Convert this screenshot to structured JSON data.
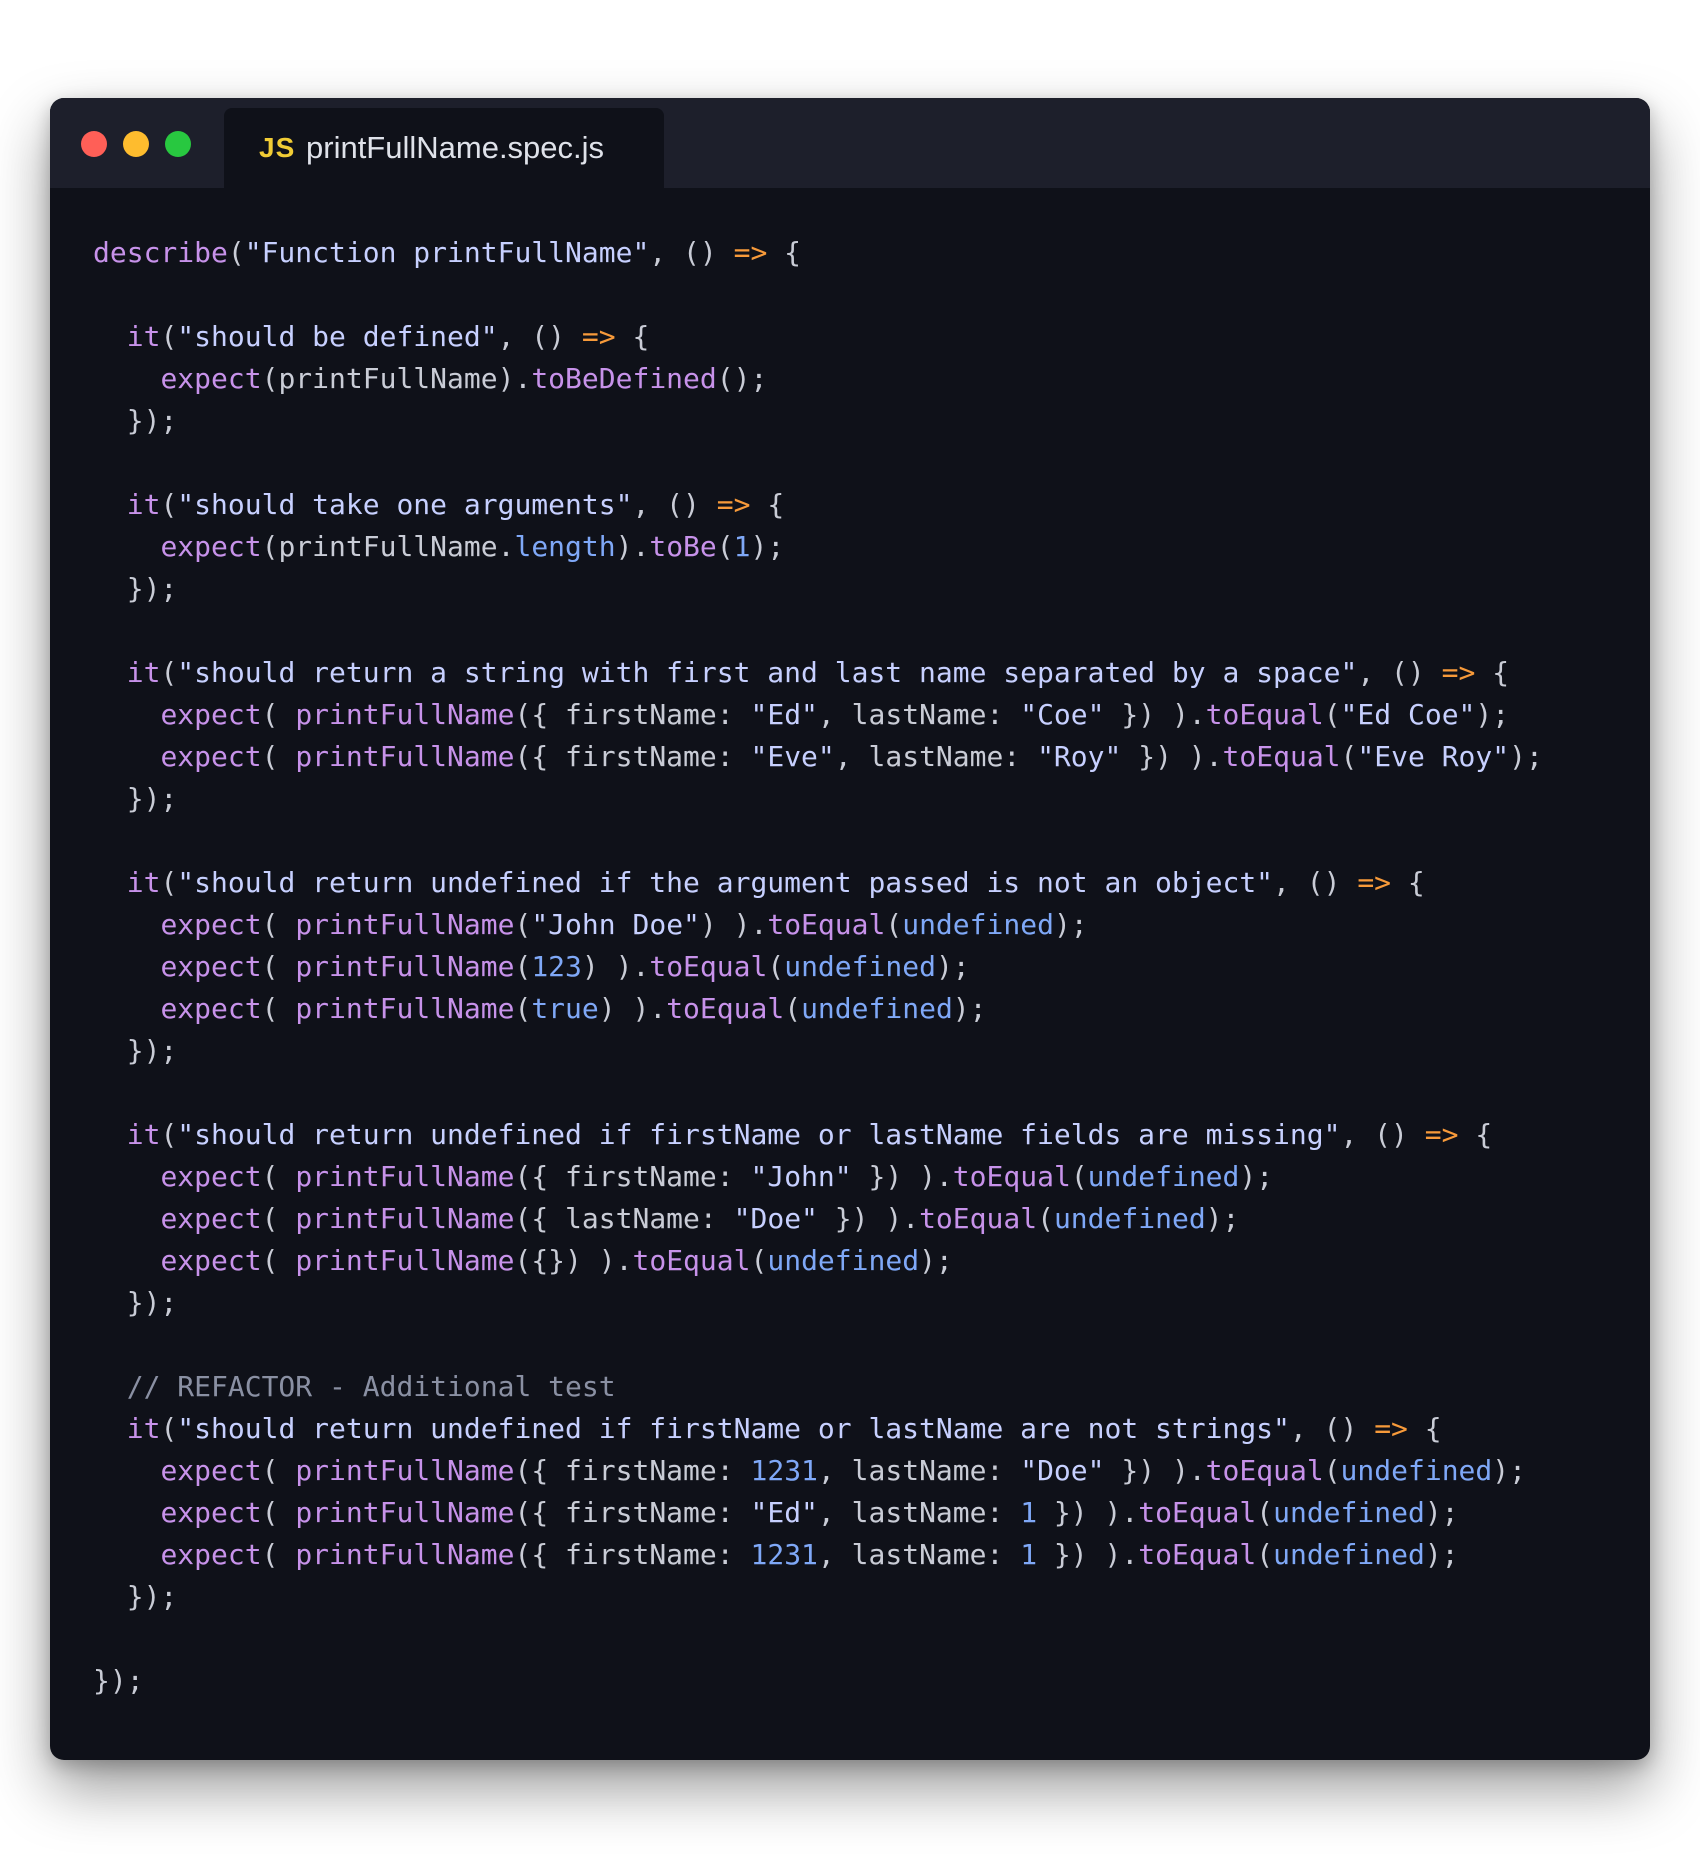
{
  "window": {
    "tab": {
      "icon_label": "JS",
      "file_name": "printFullName.spec.js"
    }
  },
  "colors": {
    "background": "#0f1119",
    "titlebar": "#1d1f2b",
    "keyword": "#c792ea",
    "string": "#c7d0ff",
    "arrow": "#f79a3a",
    "number": "#7fa8f7",
    "comment": "#8a90a3",
    "traffic_red": "#ff5f57",
    "traffic_yellow": "#febc2e",
    "traffic_green": "#28c840"
  },
  "code_lines": [
    [
      [
        "k",
        "describe"
      ],
      [
        "p",
        "("
      ],
      [
        "s",
        "\"Function printFullName\""
      ],
      [
        "p",
        ", () "
      ],
      [
        "a",
        "=>"
      ],
      [
        "p",
        " {"
      ]
    ],
    [],
    [
      [
        "p",
        "  "
      ],
      [
        "k",
        "it"
      ],
      [
        "p",
        "("
      ],
      [
        "s",
        "\"should be defined\""
      ],
      [
        "p",
        ", () "
      ],
      [
        "a",
        "=>"
      ],
      [
        "p",
        " {"
      ]
    ],
    [
      [
        "p",
        "    "
      ],
      [
        "k",
        "expect"
      ],
      [
        "p",
        "(printFullName)."
      ],
      [
        "k",
        "toBeDefined"
      ],
      [
        "p",
        "();"
      ]
    ],
    [
      [
        "p",
        "  });"
      ]
    ],
    [],
    [
      [
        "p",
        "  "
      ],
      [
        "k",
        "it"
      ],
      [
        "p",
        "("
      ],
      [
        "s",
        "\"should take one arguments\""
      ],
      [
        "p",
        ", () "
      ],
      [
        "a",
        "=>"
      ],
      [
        "p",
        " {"
      ]
    ],
    [
      [
        "p",
        "    "
      ],
      [
        "k",
        "expect"
      ],
      [
        "p",
        "(printFullName."
      ],
      [
        "n",
        "length"
      ],
      [
        "p",
        ")."
      ],
      [
        "k",
        "toBe"
      ],
      [
        "p",
        "("
      ],
      [
        "n",
        "1"
      ],
      [
        "p",
        ");"
      ]
    ],
    [
      [
        "p",
        "  });"
      ]
    ],
    [],
    [
      [
        "p",
        "  "
      ],
      [
        "k",
        "it"
      ],
      [
        "p",
        "("
      ],
      [
        "s",
        "\"should return a string with first and last name separated by a space\""
      ],
      [
        "p",
        ", () "
      ],
      [
        "a",
        "=>"
      ],
      [
        "p",
        " {"
      ]
    ],
    [
      [
        "p",
        "    "
      ],
      [
        "k",
        "expect"
      ],
      [
        "p",
        "( "
      ],
      [
        "k",
        "printFullName"
      ],
      [
        "p",
        "({ firstName: "
      ],
      [
        "s",
        "\"Ed\""
      ],
      [
        "p",
        ", lastName: "
      ],
      [
        "s",
        "\"Coe\""
      ],
      [
        "p",
        " }) )."
      ],
      [
        "k",
        "toEqual"
      ],
      [
        "p",
        "("
      ],
      [
        "s",
        "\"Ed Coe\""
      ],
      [
        "p",
        ");"
      ]
    ],
    [
      [
        "p",
        "    "
      ],
      [
        "k",
        "expect"
      ],
      [
        "p",
        "( "
      ],
      [
        "k",
        "printFullName"
      ],
      [
        "p",
        "({ firstName: "
      ],
      [
        "s",
        "\"Eve\""
      ],
      [
        "p",
        ", lastName: "
      ],
      [
        "s",
        "\"Roy\""
      ],
      [
        "p",
        " }) )."
      ],
      [
        "k",
        "toEqual"
      ],
      [
        "p",
        "("
      ],
      [
        "s",
        "\"Eve Roy\""
      ],
      [
        "p",
        ");"
      ]
    ],
    [
      [
        "p",
        "  });"
      ]
    ],
    [],
    [
      [
        "p",
        "  "
      ],
      [
        "k",
        "it"
      ],
      [
        "p",
        "("
      ],
      [
        "s",
        "\"should return undefined if the argument passed is not an object\""
      ],
      [
        "p",
        ", () "
      ],
      [
        "a",
        "=>"
      ],
      [
        "p",
        " {"
      ]
    ],
    [
      [
        "p",
        "    "
      ],
      [
        "k",
        "expect"
      ],
      [
        "p",
        "( "
      ],
      [
        "k",
        "printFullName"
      ],
      [
        "p",
        "("
      ],
      [
        "s",
        "\"John Doe\""
      ],
      [
        "p",
        ") )."
      ],
      [
        "k",
        "toEqual"
      ],
      [
        "p",
        "("
      ],
      [
        "n",
        "undefined"
      ],
      [
        "p",
        ");"
      ]
    ],
    [
      [
        "p",
        "    "
      ],
      [
        "k",
        "expect"
      ],
      [
        "p",
        "( "
      ],
      [
        "k",
        "printFullName"
      ],
      [
        "p",
        "("
      ],
      [
        "n",
        "123"
      ],
      [
        "p",
        ") )."
      ],
      [
        "k",
        "toEqual"
      ],
      [
        "p",
        "("
      ],
      [
        "n",
        "undefined"
      ],
      [
        "p",
        ");"
      ]
    ],
    [
      [
        "p",
        "    "
      ],
      [
        "k",
        "expect"
      ],
      [
        "p",
        "( "
      ],
      [
        "k",
        "printFullName"
      ],
      [
        "p",
        "("
      ],
      [
        "n",
        "true"
      ],
      [
        "p",
        ") )."
      ],
      [
        "k",
        "toEqual"
      ],
      [
        "p",
        "("
      ],
      [
        "n",
        "undefined"
      ],
      [
        "p",
        ");"
      ]
    ],
    [
      [
        "p",
        "  });"
      ]
    ],
    [],
    [
      [
        "p",
        "  "
      ],
      [
        "k",
        "it"
      ],
      [
        "p",
        "("
      ],
      [
        "s",
        "\"should return undefined if firstName or lastName fields are missing\""
      ],
      [
        "p",
        ", () "
      ],
      [
        "a",
        "=>"
      ],
      [
        "p",
        " {"
      ]
    ],
    [
      [
        "p",
        "    "
      ],
      [
        "k",
        "expect"
      ],
      [
        "p",
        "( "
      ],
      [
        "k",
        "printFullName"
      ],
      [
        "p",
        "({ firstName: "
      ],
      [
        "s",
        "\"John\""
      ],
      [
        "p",
        " }) )."
      ],
      [
        "k",
        "toEqual"
      ],
      [
        "p",
        "("
      ],
      [
        "n",
        "undefined"
      ],
      [
        "p",
        ");"
      ]
    ],
    [
      [
        "p",
        "    "
      ],
      [
        "k",
        "expect"
      ],
      [
        "p",
        "( "
      ],
      [
        "k",
        "printFullName"
      ],
      [
        "p",
        "({ lastName: "
      ],
      [
        "s",
        "\"Doe\""
      ],
      [
        "p",
        " }) )."
      ],
      [
        "k",
        "toEqual"
      ],
      [
        "p",
        "("
      ],
      [
        "n",
        "undefined"
      ],
      [
        "p",
        ");"
      ]
    ],
    [
      [
        "p",
        "    "
      ],
      [
        "k",
        "expect"
      ],
      [
        "p",
        "( "
      ],
      [
        "k",
        "printFullName"
      ],
      [
        "p",
        "({}) )."
      ],
      [
        "k",
        "toEqual"
      ],
      [
        "p",
        "("
      ],
      [
        "n",
        "undefined"
      ],
      [
        "p",
        ");"
      ]
    ],
    [
      [
        "p",
        "  });"
      ]
    ],
    [],
    [
      [
        "p",
        "  "
      ],
      [
        "c",
        "// REFACTOR - Additional test"
      ]
    ],
    [
      [
        "p",
        "  "
      ],
      [
        "k",
        "it"
      ],
      [
        "p",
        "("
      ],
      [
        "s",
        "\"should return undefined if firstName or lastName are not strings\""
      ],
      [
        "p",
        ", () "
      ],
      [
        "a",
        "=>"
      ],
      [
        "p",
        " {"
      ]
    ],
    [
      [
        "p",
        "    "
      ],
      [
        "k",
        "expect"
      ],
      [
        "p",
        "( "
      ],
      [
        "k",
        "printFullName"
      ],
      [
        "p",
        "({ firstName: "
      ],
      [
        "n",
        "1231"
      ],
      [
        "p",
        ", lastName: "
      ],
      [
        "s",
        "\"Doe\""
      ],
      [
        "p",
        " }) )."
      ],
      [
        "k",
        "toEqual"
      ],
      [
        "p",
        "("
      ],
      [
        "n",
        "undefined"
      ],
      [
        "p",
        ");"
      ]
    ],
    [
      [
        "p",
        "    "
      ],
      [
        "k",
        "expect"
      ],
      [
        "p",
        "( "
      ],
      [
        "k",
        "printFullName"
      ],
      [
        "p",
        "({ firstName: "
      ],
      [
        "s",
        "\"Ed\""
      ],
      [
        "p",
        ", lastName: "
      ],
      [
        "n",
        "1"
      ],
      [
        "p",
        " }) )."
      ],
      [
        "k",
        "toEqual"
      ],
      [
        "p",
        "("
      ],
      [
        "n",
        "undefined"
      ],
      [
        "p",
        ");"
      ]
    ],
    [
      [
        "p",
        "    "
      ],
      [
        "k",
        "expect"
      ],
      [
        "p",
        "( "
      ],
      [
        "k",
        "printFullName"
      ],
      [
        "p",
        "({ firstName: "
      ],
      [
        "n",
        "1231"
      ],
      [
        "p",
        ", lastName: "
      ],
      [
        "n",
        "1"
      ],
      [
        "p",
        " }) )."
      ],
      [
        "k",
        "toEqual"
      ],
      [
        "p",
        "("
      ],
      [
        "n",
        "undefined"
      ],
      [
        "p",
        ");"
      ]
    ],
    [
      [
        "p",
        "  });"
      ]
    ],
    [],
    [
      [
        "p",
        "});"
      ]
    ]
  ]
}
